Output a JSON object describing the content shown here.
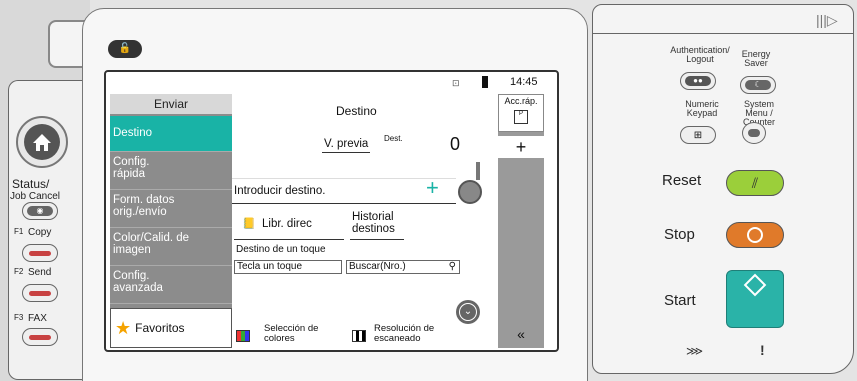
{
  "left_panel": {
    "status_label": "Status/",
    "job_cancel_label": "Job Cancel",
    "f1_label": "F1",
    "copy_label": "Copy",
    "f2_label": "F2",
    "send_label": "Send",
    "f3_label": "F3",
    "fax_label": "FAX"
  },
  "status_bar": {
    "time": "14:45"
  },
  "menu": {
    "header": "Enviar",
    "items": [
      {
        "label": "Destino"
      },
      {
        "label": "Config. rápida"
      },
      {
        "label": "Form. datos orig./envío"
      },
      {
        "label": "Color/Calid. de imagen"
      },
      {
        "label": "Config. avanzada"
      }
    ],
    "favorites": "Favoritos"
  },
  "main": {
    "title": "Destino",
    "preview_button": "V. previa",
    "dest_label": "Dest.",
    "dest_count": "0",
    "enter_destination": "Introducir destino.",
    "address_book": "Libr. direc",
    "history": "Historial destinos",
    "one_touch_label": "Destino de un toque",
    "one_touch_key": "Tecla un toque",
    "search_number": "Buscar(Nro.)",
    "color_selection": "Selección de colores",
    "scan_resolution": "Resolución de escaneado"
  },
  "quick": {
    "header": "Acc.ráp.",
    "add": "+",
    "collapse": "«"
  },
  "right_panel": {
    "auth_label": "Authentication/ Logout",
    "energy_label": "Energy Saver",
    "numeric_label": "Numeric Keypad",
    "system_menu_label": "System Menu / Counter",
    "reset_label": "Reset",
    "stop_label": "Stop",
    "start_label": "Start",
    "colors": {
      "reset": "#9bcf3a",
      "stop": "#e07a2a",
      "start": "#2ab3a8",
      "accent": "#19b3a6"
    }
  }
}
